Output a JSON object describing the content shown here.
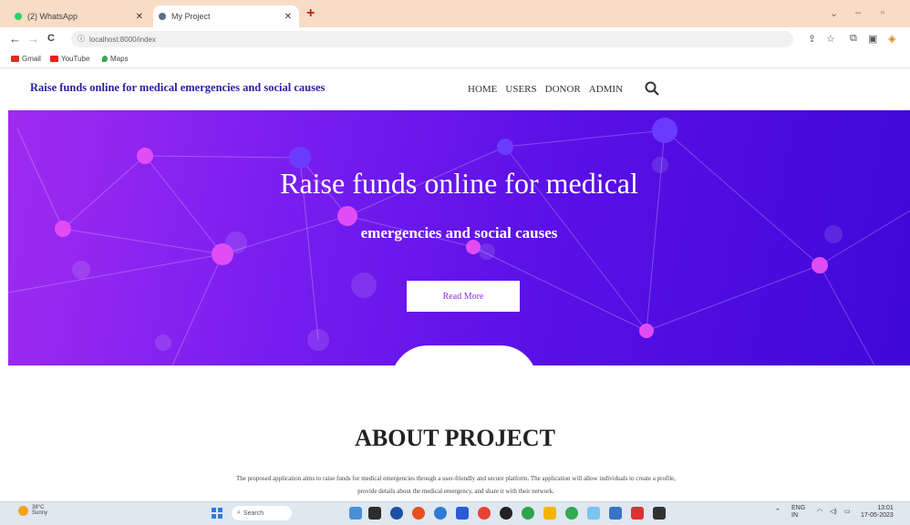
{
  "browser": {
    "tabs": [
      {
        "title": "(2) WhatsApp",
        "active": false,
        "icon": "whatsapp-icon",
        "color": "#25d366"
      },
      {
        "title": "My Project",
        "active": true,
        "icon": "globe-icon",
        "color": "#5a6c86"
      }
    ],
    "new_tab_glyph": "+",
    "window_controls": [
      "⌄",
      "–",
      "▫"
    ],
    "nav": {
      "back": "←",
      "forward": "→",
      "reload": "C"
    },
    "url": "localhost:8000/index",
    "bookmarks": [
      {
        "label": "Gmail",
        "icon": "gmail-icon",
        "color": "#d93025"
      },
      {
        "label": "YouTube",
        "icon": "youtube-icon",
        "color": "#e62117"
      },
      {
        "label": "Maps",
        "icon": "maps-icon",
        "color": "#34a853"
      }
    ],
    "toolbar_icons": [
      "share-icon",
      "star-icon",
      "extensions-icon",
      "sidepanel-icon",
      "profile-icon"
    ]
  },
  "site": {
    "brand": "Raise funds online for medical emergencies and social causes",
    "menu": [
      "HOME",
      "USERS",
      "DONOR",
      "ADMIN"
    ],
    "hero": {
      "title": "Raise funds online for medical",
      "subtitle": "emergencies and social causes",
      "button": "Read More"
    },
    "about": {
      "title": "ABOUT PROJECT",
      "text_line1": "The proposed application aims to raise funds for medical emergencies through a user-friendly and secure platform. The application will allow individuals to create a profile,",
      "text_line2": "provide details about the medical emergency, and share it with their network."
    }
  },
  "taskbar": {
    "weather_temp": "38°C",
    "weather_desc": "Sunny",
    "search_label": "Search",
    "lang": "ENG",
    "lang_region": "IN",
    "time": "13:01",
    "date": "17-05-2023"
  },
  "colors": {
    "tabbar": "#f9dcc6",
    "brand": "#2b1ea8",
    "hero_start": "#a02bf0",
    "hero_end": "#3f08d8",
    "button_text": "#8a2fd8"
  }
}
